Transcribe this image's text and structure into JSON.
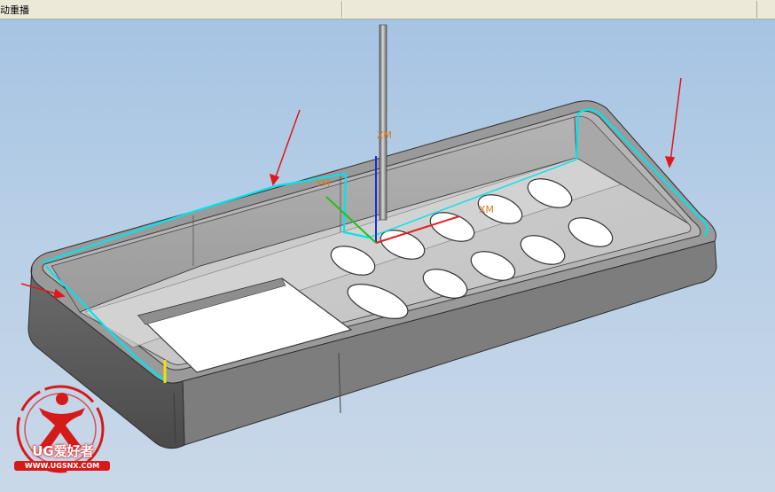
{
  "window": {
    "title": "动重播"
  },
  "viewport": {
    "axis_labels": {
      "zm_tool": "ZM",
      "ym_tool": "YM",
      "xm_tool": "XM"
    }
  },
  "watermark": {
    "brand_latin": "UG",
    "brand_cjk": "爱好者",
    "url": "WWW.UGSNX.COM"
  },
  "colors": {
    "background_top": "#a6c4e3",
    "background_bottom": "#c9d8e8",
    "toolpath": "#00e5ee",
    "annotation_arrow": "#e01818",
    "axis_orange": "#e07a20",
    "axis_blue": "#1030d0",
    "axis_green": "#20c020",
    "axis_red": "#e02020",
    "logo_red": "#d51a1a"
  }
}
